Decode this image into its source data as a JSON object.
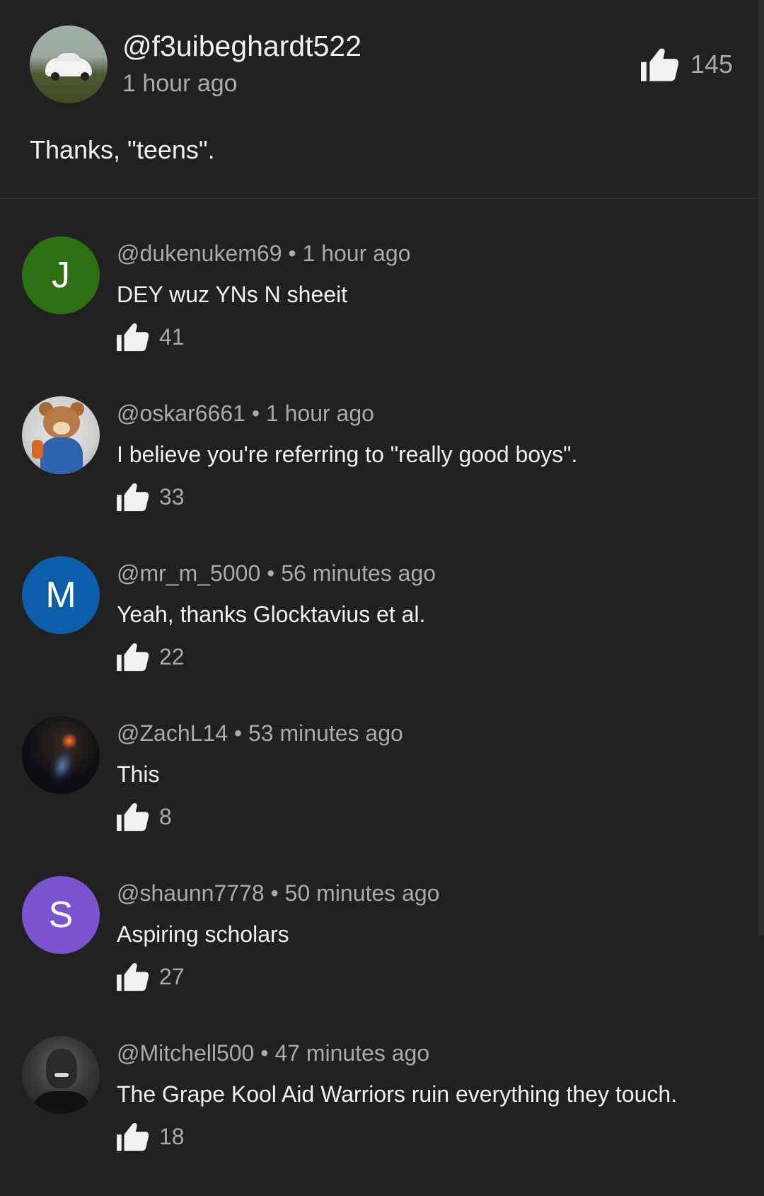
{
  "top_comment": {
    "username": "@f3uibeghardt522",
    "time": "1 hour ago",
    "text": "Thanks, \"teens\".",
    "likes": "145"
  },
  "replies": [
    {
      "avatar_letter": "J",
      "avatar_color": "#2e6f14",
      "meta": "@dukenukem69 • 1 hour ago",
      "text": "DEY wuz YNs N sheeit",
      "likes": "41"
    },
    {
      "avatar_letter": "",
      "avatar_color": "",
      "meta": "@oskar6661 • 1 hour ago",
      "text": "I believe you're referring to \"really good boys\".",
      "likes": "33"
    },
    {
      "avatar_letter": "M",
      "avatar_color": "#0c5daa",
      "meta": "@mr_m_5000 • 56 minutes ago",
      "text": "Yeah, thanks Glocktavius et al.",
      "likes": "22"
    },
    {
      "avatar_letter": "",
      "avatar_color": "",
      "meta": "@ZachL14 • 53 minutes ago",
      "text": "This",
      "likes": "8"
    },
    {
      "avatar_letter": "S",
      "avatar_color": "#7b53d0",
      "meta": "@shaunn7778 • 50 minutes ago",
      "text": "Aspiring scholars",
      "likes": "27"
    },
    {
      "avatar_letter": "",
      "avatar_color": "",
      "meta": "@Mitchell500 • 47 minutes ago",
      "text": "The Grape Kool Aid Warriors ruin everything they touch.",
      "likes": "18"
    }
  ],
  "icons": {
    "like": "thumbs-up-icon"
  }
}
